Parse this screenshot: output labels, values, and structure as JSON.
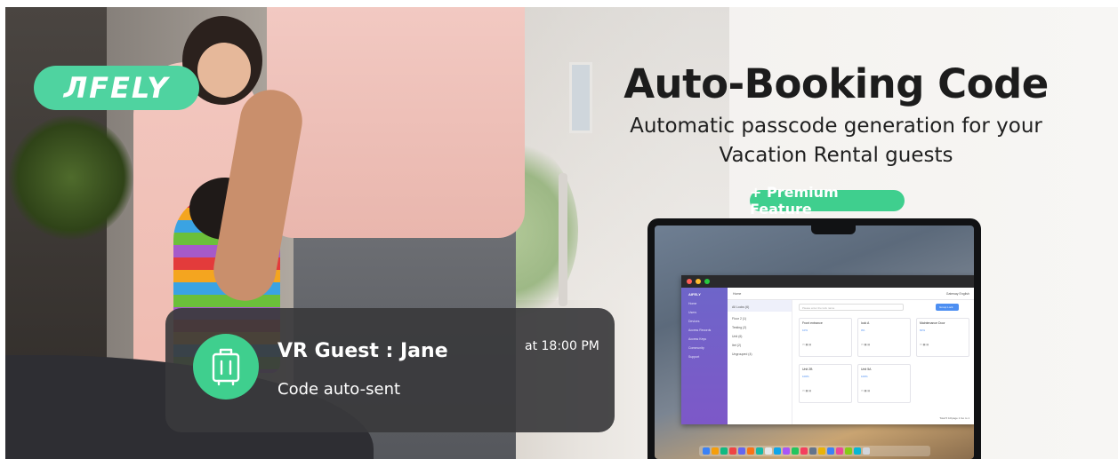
{
  "brand": {
    "logo_text": "ЛFELY"
  },
  "headline": {
    "title": "Auto-Booking Code",
    "subtitle_line1": "Automatic passcode generation for your",
    "subtitle_line2": "Vacation Rental guests",
    "badge": "+ Premium Feature"
  },
  "notification": {
    "icon": "suitcase-icon",
    "title": "VR Guest : Jane",
    "time": "at 18:00 PM",
    "body": "Code auto-sent"
  },
  "laptop_app": {
    "brand": "AIFELY",
    "sidebar_items": [
      "Home",
      "Users",
      "Devices",
      "Access Records",
      "Access Keys",
      "Community",
      "Support"
    ],
    "top_title": "Home",
    "top_right": "Gateway  English",
    "groups": [
      "All Locks (6)",
      "Floor 2 (1)",
      "Testing (2)",
      "Unit (6)",
      "Itet (2)",
      "Ungrouped (4)"
    ],
    "search_placeholder": "Please enter the lock name",
    "add_button": "Group Lock",
    "cards": [
      {
        "name": "Front entrance",
        "stat": "10%"
      },
      {
        "name": "lock A",
        "stat": "0%"
      },
      {
        "name": "Maintenance Door",
        "stat": "60%"
      },
      {
        "name": "Unit 2B",
        "stat": "100%"
      },
      {
        "name": "Unit 5A",
        "stat": "100%"
      }
    ],
    "pager": "Total 5  10/page  1  Go to  1"
  },
  "colors": {
    "accent": "#3fcf8e",
    "notif_bg": "#3a3a3c",
    "sidebar": "#7160c8"
  }
}
